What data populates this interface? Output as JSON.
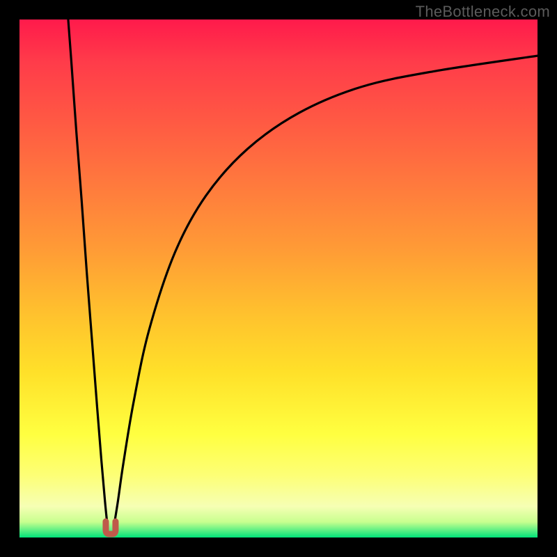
{
  "watermark": "TheBottleneck.com",
  "chart_data": {
    "type": "line",
    "title": "",
    "xlabel": "",
    "ylabel": "",
    "xlim": [
      0,
      100
    ],
    "ylim": [
      0,
      100
    ],
    "grid": false,
    "legend": false,
    "background_gradient": {
      "top": "#ff1a4b",
      "y80": "#ffff40",
      "bottom": "#00e37a",
      "meaning": "red=high bottleneck, green=low bottleneck"
    },
    "optimal_marker": {
      "x": 17.6,
      "y": 0,
      "color": "#bf5a4a",
      "shape": "u-notch"
    },
    "series": [
      {
        "name": "left-branch",
        "description": "Steep descending branch from top-left down to optimal point",
        "x": [
          9.4,
          10.0,
          11.0,
          12.0,
          13.0,
          14.0,
          15.0,
          15.8,
          16.5,
          17.0
        ],
        "values": [
          100,
          92,
          78,
          65,
          51,
          38,
          25,
          15,
          7,
          2
        ]
      },
      {
        "name": "right-branch",
        "description": "Saturating ascending branch from optimal point toward top-right",
        "x": [
          18.2,
          19.0,
          20.0,
          22.0,
          25.0,
          30.0,
          36.0,
          44.0,
          54.0,
          66.0,
          80.0,
          100.0
        ],
        "values": [
          2,
          7,
          14,
          26,
          40,
          55,
          66,
          75,
          82,
          87,
          90,
          93
        ]
      }
    ]
  }
}
